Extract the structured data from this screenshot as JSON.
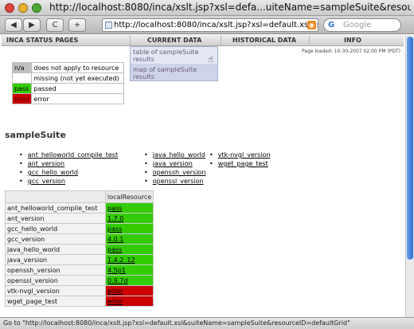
{
  "window": {
    "title": "http://localhost:8080/inca/xslt.jsp?xsl=defa...uiteName=sampleSuite&resourceID=defaultGrid"
  },
  "toolbar": {
    "back": "◀",
    "forward": "▶",
    "reload": "C",
    "add": "+",
    "url": "http://localhost:8080/inca/xslt.jsp?xsl=default.xsl&suiteN",
    "search_placeholder": "Google",
    "search_engine": "G"
  },
  "menu": {
    "items": [
      "INCA STATUS PAGES",
      "CURRENT DATA",
      "HISTORICAL DATA",
      "INFO"
    ],
    "dropdown": [
      "table of sampleSuite results",
      "map of sampleSuite results"
    ]
  },
  "page_loaded": "Page loaded: 10-30-2007 02:00 PM (PDT)",
  "legend": [
    {
      "key": "n/a",
      "desc": "does not apply to resource",
      "color": "#c0c0c0",
      "text_color": "#000000"
    },
    {
      "key": "",
      "desc": "missing (not yet executed)",
      "color": "#ffffff",
      "text_color": "#000000"
    },
    {
      "key": "pass",
      "desc": "passed",
      "color": "#33cc00",
      "text_color": "#000000"
    },
    {
      "key": "error",
      "desc": "error",
      "color": "#cc0000",
      "text_color": "#5a0000"
    }
  ],
  "suite": {
    "title": "sampleSuite",
    "links_col1": [
      "ant_helloworld_compile_test",
      "ant_version",
      "gcc_hello_world",
      "gcc_version"
    ],
    "links_col2": [
      "java_hello_world",
      "java_version",
      "openssh_version",
      "openssl_version"
    ],
    "links_col3": [
      "vtk-nvgl_version",
      "wget_page_test"
    ]
  },
  "results": {
    "header": "localResource",
    "rows": [
      {
        "name": "ant_helloworld_compile_test",
        "result": "pass",
        "status": "pass"
      },
      {
        "name": "ant_version",
        "result": "1.7.0",
        "status": "pass"
      },
      {
        "name": "gcc_hello_world",
        "result": "pass",
        "status": "pass"
      },
      {
        "name": "gcc_version",
        "result": "4.0.1",
        "status": "pass"
      },
      {
        "name": "java_hello_world",
        "result": "pass",
        "status": "pass"
      },
      {
        "name": "java_version",
        "result": "1.4.2_12",
        "status": "pass"
      },
      {
        "name": "openssh_version",
        "result": "4.5p1",
        "status": "pass"
      },
      {
        "name": "openssl_version",
        "result": "0.9.7d",
        "status": "pass"
      },
      {
        "name": "vtk-nvgl_version",
        "result": "error",
        "status": "error"
      },
      {
        "name": "wget_page_test",
        "result": "error",
        "status": "error"
      }
    ],
    "status_colors": {
      "pass": "#33cc00",
      "error": "#cc0000"
    }
  },
  "statusbar": {
    "text": "Go to \"http://localhost:8080/inca/xslt.jsp?xsl=default.xsl&suiteName=sampleSuite&resourceID=defaultGrid\""
  }
}
